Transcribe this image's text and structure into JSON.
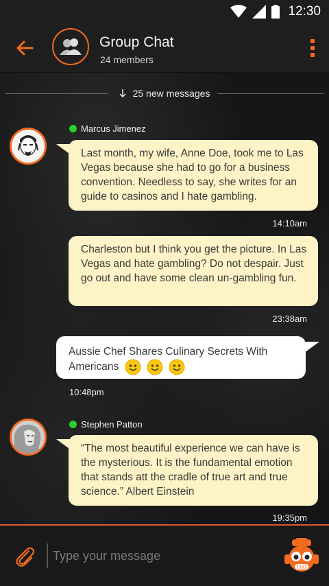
{
  "status_bar": {
    "time": "12:30"
  },
  "header": {
    "title": "Group Chat",
    "subtitle": "24 members"
  },
  "divider": {
    "label": "25 new messages"
  },
  "messages": [
    {
      "sender": "Marcus Jimenez",
      "text": "Last month, my wife, Anne Doe, took me to Las Vegas because she had to go for a business convention. Needless to say, she writes for an guide to casinos and I hate gambling.",
      "time": "14:10am"
    },
    {
      "text": "Charleston but I think you get the picture. In Las Vegas and hate gambling? Do not despair. Just go out and have some clean un-gambling fun.",
      "time": "23:38am"
    },
    {
      "text": "Aussie Chef Shares Culinary Secrets With Americans",
      "time": "10:48pm"
    },
    {
      "sender": "Stephen Patton",
      "text": "“The most beautiful experience we can have is the mysterious. It is the fundamental emotion that stands att the cradle of true art and true science.” Albert Einstein",
      "time": "19:35pm"
    }
  ],
  "composer": {
    "placeholder": "Type your message"
  },
  "colors": {
    "accent": "#f26b21",
    "bubble": "#fdf3c6",
    "online": "#29d12a"
  },
  "icons": [
    "wifi-icon",
    "signal-icon",
    "battery-icon",
    "back-arrow-icon",
    "group-icon",
    "overflow-menu-icon",
    "down-arrow-icon",
    "paperclip-icon",
    "robot-send-icon",
    "smiley-icon"
  ]
}
